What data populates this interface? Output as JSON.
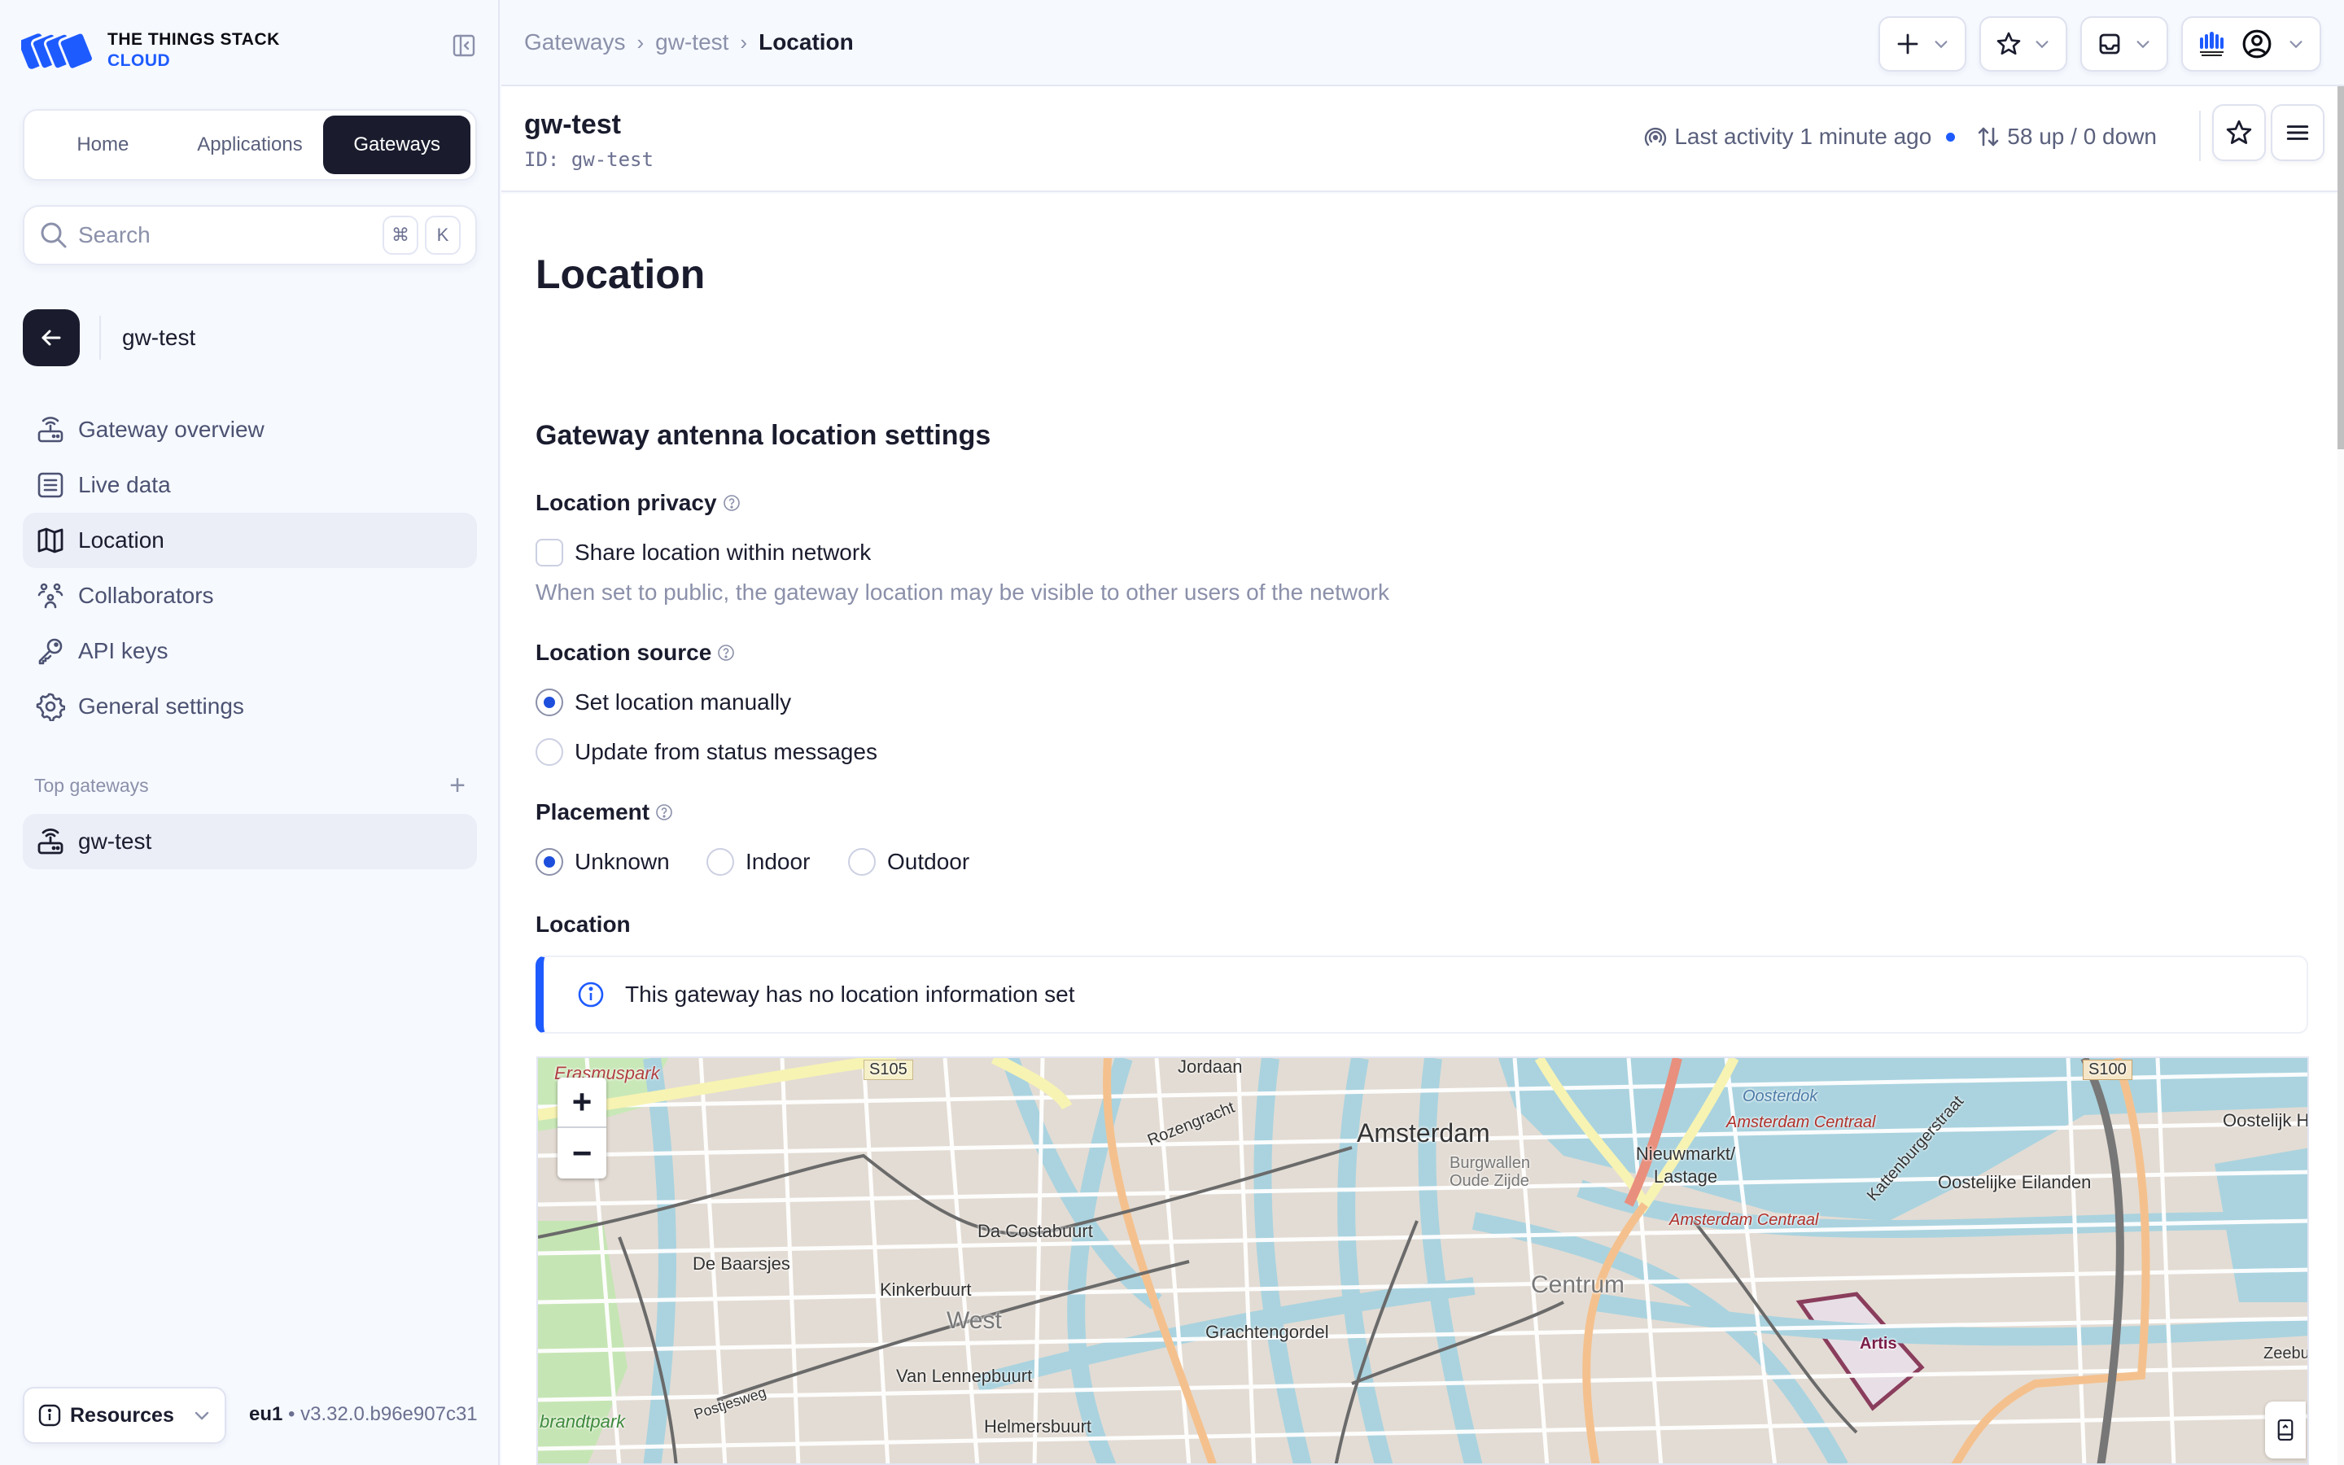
{
  "app": {
    "logo_line1": "THE THINGS STACK",
    "logo_line2": "CLOUD",
    "brand_color": "#1e5bff",
    "dark_color": "#1a1c2e"
  },
  "sidebar": {
    "switch_tabs": [
      {
        "label": "Home",
        "active": false
      },
      {
        "label": "Applications",
        "active": false
      },
      {
        "label": "Gateways",
        "active": true
      }
    ],
    "search": {
      "placeholder": "Search",
      "value": "",
      "shortcut_mod": "⌘",
      "shortcut_key": "K"
    },
    "entity_title": "gw-test",
    "menu": [
      {
        "label": "Gateway overview",
        "icon": "router-icon",
        "active": false
      },
      {
        "label": "Live data",
        "icon": "list-icon",
        "active": false
      },
      {
        "label": "Location",
        "icon": "map-icon",
        "active": true
      },
      {
        "label": "Collaborators",
        "icon": "users-icon",
        "active": false
      },
      {
        "label": "API keys",
        "icon": "key-icon",
        "active": false
      },
      {
        "label": "General settings",
        "icon": "gear-icon",
        "active": false
      }
    ],
    "top_gateways_label": "Top gateways",
    "top_gateways": [
      {
        "label": "gw-test"
      }
    ],
    "resources_label": "Resources",
    "cluster": "eu1",
    "version": "v3.32.0.b96e907c31"
  },
  "topbar": {
    "breadcrumb": [
      "Gateways",
      "gw-test",
      "Location"
    ]
  },
  "header": {
    "name": "gw-test",
    "id_label": "ID:",
    "id_value": "gw-test",
    "last_activity": "Last activity 1 minute ago",
    "traffic": "58 up / 0 down"
  },
  "main": {
    "title": "Location",
    "section_title": "Gateway antenna location settings",
    "privacy": {
      "label": "Location privacy",
      "checkbox_label": "Share location within network",
      "checked": false,
      "help": "When set to public, the gateway location may be visible to other users of the network"
    },
    "source": {
      "label": "Location source",
      "options": [
        {
          "label": "Set location manually",
          "selected": true
        },
        {
          "label": "Update from status messages",
          "selected": false
        }
      ]
    },
    "placement": {
      "label": "Placement",
      "options": [
        {
          "label": "Unknown",
          "selected": true
        },
        {
          "label": "Indoor",
          "selected": false
        },
        {
          "label": "Outdoor",
          "selected": false
        }
      ]
    },
    "location_label": "Location",
    "notice": "This gateway has no location information set",
    "map": {
      "zoom_in": "+",
      "zoom_out": "−",
      "labels": [
        {
          "text": "Erasmuspark",
          "kind": "park"
        },
        {
          "text": "S105",
          "kind": "shield"
        },
        {
          "text": "Jordaan",
          "kind": "area"
        },
        {
          "text": "Rozengracht",
          "kind": "street"
        },
        {
          "text": "Amsterdam",
          "kind": "city"
        },
        {
          "text": "Burgwallen Oude Zijde",
          "kind": "district"
        },
        {
          "text": "Nieuwmarkt/ Lastage",
          "kind": "area"
        },
        {
          "text": "Amsterdam Centraal",
          "kind": "station"
        },
        {
          "text": "Amsterdam Centraal",
          "kind": "station"
        },
        {
          "text": "Oosterdok",
          "kind": "water"
        },
        {
          "text": "Kattenburgerstraat",
          "kind": "street"
        },
        {
          "text": "Oostelijke Eilanden",
          "kind": "area"
        },
        {
          "text": "Oostelijk Hav",
          "kind": "area"
        },
        {
          "text": "S100",
          "kind": "shield"
        },
        {
          "text": "Da Costabuurt",
          "kind": "area"
        },
        {
          "text": "De Baarsjes",
          "kind": "area"
        },
        {
          "text": "Kinkerbuurt",
          "kind": "area"
        },
        {
          "text": "West",
          "kind": "district"
        },
        {
          "text": "Centrum",
          "kind": "district"
        },
        {
          "text": "Grachtengordel",
          "kind": "area"
        },
        {
          "text": "Van Lennepbuurt",
          "kind": "area"
        },
        {
          "text": "Helmersbuurt",
          "kind": "area"
        },
        {
          "text": "Artis",
          "kind": "poi"
        },
        {
          "text": "Postjesweg",
          "kind": "street"
        },
        {
          "text": "brandtpark",
          "kind": "park"
        },
        {
          "text": "Zeebu",
          "kind": "area"
        }
      ]
    }
  }
}
